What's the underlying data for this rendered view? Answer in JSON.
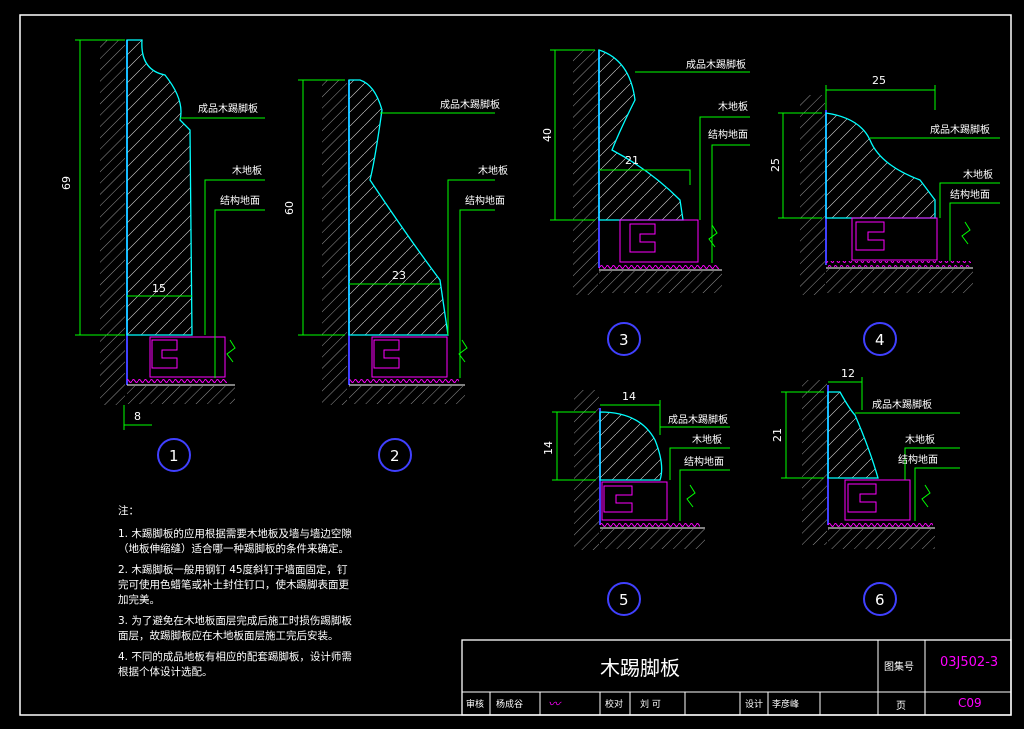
{
  "details": [
    {
      "number": "1",
      "labels": {
        "baseboard": "成品木踢脚板",
        "floor": "木地板",
        "structure": "结构地面"
      },
      "dims": {
        "height": "69",
        "thickness": "15",
        "offset": "8"
      }
    },
    {
      "number": "2",
      "labels": {
        "baseboard": "成品木踢脚板",
        "floor": "木地板",
        "structure": "结构地面"
      },
      "dims": {
        "height": "60",
        "thickness": "23"
      }
    },
    {
      "number": "3",
      "labels": {
        "baseboard": "成品木踢脚板",
        "floor": "木地板",
        "structure": "结构地面"
      },
      "dims": {
        "height": "40",
        "thickness": "21"
      }
    },
    {
      "number": "4",
      "labels": {
        "baseboard": "成品木踢脚板",
        "floor": "木地板",
        "structure": "结构地面"
      },
      "dims": {
        "height": "25",
        "width": "25"
      }
    },
    {
      "number": "5",
      "labels": {
        "baseboard": "成品木踢脚板",
        "floor": "木地板",
        "structure": "结构地面"
      },
      "dims": {
        "height": "14",
        "width": "14"
      }
    },
    {
      "number": "6",
      "labels": {
        "baseboard": "成品木踢脚板",
        "floor": "木地板",
        "structure": "结构地面"
      },
      "dims": {
        "height": "21",
        "width": "12"
      }
    }
  ],
  "notes": {
    "heading": "注：",
    "items": [
      "1. 木踢脚板的应用根据需要木地板及墙与墙边空隙（地板伸缩缝）适合哪一种踢脚板的条件来确定。",
      "2. 木踢脚板一般用钢钉    45度斜钉于墙面固定，钉完可使用色蜡笔或补土封住钉口，使木踢脚表面更加完美。",
      "3. 为了避免在木地板面层完成后施工时损伤踢脚板面层，故踢脚板应在木地板面层施工完后安装。",
      "4. 不同的成品地板有相应的配套踢脚板，设计师需根据个体设计选配。"
    ]
  },
  "title_block": {
    "title": "木踢脚板",
    "atlas_label": "图集号",
    "atlas_number": "03J502-3",
    "page_label": "页",
    "page_number": "C09",
    "review_label": "审核",
    "reviewer": "杨成谷",
    "check_label": "校对",
    "checker": "刘  可",
    "design_label": "设计",
    "designer": "李彦峰"
  },
  "colors": {
    "board": "#00ffff",
    "dim": "#00ff00",
    "wall": "#ffffff",
    "floor": "#ff00ff",
    "wallline": "#4040ff",
    "circle": "#4040ff"
  }
}
